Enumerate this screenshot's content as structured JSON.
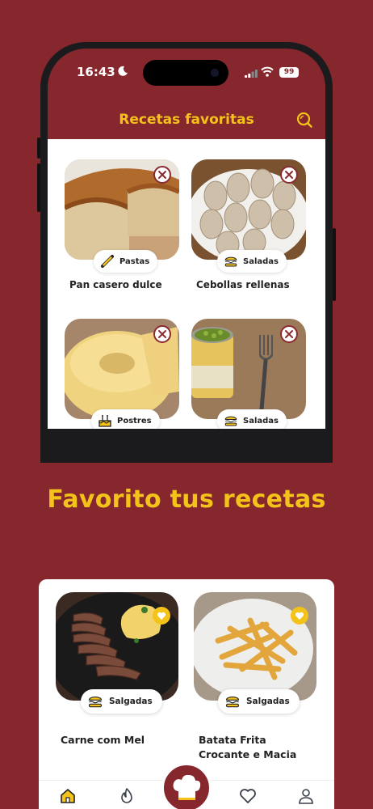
{
  "statusbar": {
    "time": "16:43",
    "battery": "99"
  },
  "app": {
    "title": "Recetas favoritas"
  },
  "favorites": [
    {
      "title": "Pan casero dulce",
      "category": "Pastas",
      "category_icon": "rolling-pin-icon"
    },
    {
      "title": "Cebollas rellenas",
      "category": "Saladas",
      "category_icon": "burger-icon"
    },
    {
      "title": "",
      "category": "Postres",
      "category_icon": "cake-icon"
    },
    {
      "title": "",
      "category": "Saladas",
      "category_icon": "burger-icon"
    }
  ],
  "headline": "Favorito tus recetas",
  "panel": {
    "recipes": [
      {
        "title": "Carne com Mel",
        "category": "Salgadas",
        "category_icon": "burger-icon"
      },
      {
        "title": "Batata Frita Crocante e Macia",
        "category": "Salgadas",
        "category_icon": "burger-icon"
      }
    ]
  },
  "tabbar": {
    "items": [
      "home-icon",
      "flame-icon",
      "chef-hat-icon",
      "heart-icon",
      "profile-icon"
    ]
  },
  "colors": {
    "background": "#86262d",
    "accent": "#f4c31a",
    "surface": "#ffffff"
  }
}
